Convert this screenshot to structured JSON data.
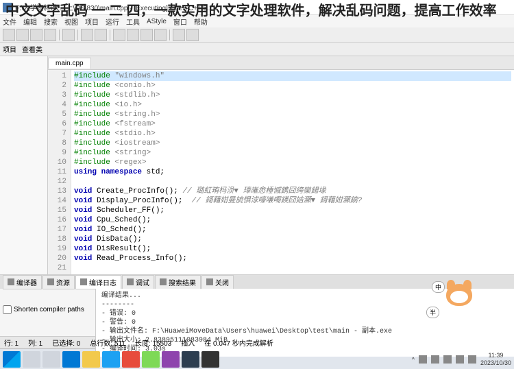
{
  "overlay": "中文文字乱码 一 二 四，一款实用的文字处理软件，解决乱码问题，提高工作效率",
  "titlebar": "F:\\大学资料\\大三上\\OS\\830\\main.cpp - [Executing] - Dev-C++ 5.11",
  "menubar": [
    "文件",
    "编辑",
    "搜索",
    "视图",
    "项目",
    "运行",
    "工具",
    "AStyle",
    "窗口",
    "帮助"
  ],
  "toolbar2": {
    "left": "项目",
    "right": "查看类"
  },
  "tab": "main.cpp",
  "code": [
    {
      "n": 1,
      "t": "#include",
      "a": "\"windows.h\"",
      "hl": true
    },
    {
      "n": 2,
      "t": "#include",
      "a": "<conio.h>"
    },
    {
      "n": 3,
      "t": "#include",
      "a": "<stdlib.h>"
    },
    {
      "n": 4,
      "t": "#include",
      "a": "<io.h>"
    },
    {
      "n": 5,
      "t": "#include",
      "a": "<string.h>"
    },
    {
      "n": 6,
      "t": "#include",
      "a": "<fstream>"
    },
    {
      "n": 7,
      "t": "#include",
      "a": "<stdio.h>"
    },
    {
      "n": 8,
      "t": "#include",
      "a": "<iostream>"
    },
    {
      "n": 9,
      "t": "#include",
      "a": "<string>"
    },
    {
      "n": 10,
      "t": "#include",
      "a": "<regex>"
    },
    {
      "n": 11,
      "kw": "using namespace",
      "id": " std;"
    },
    {
      "n": 12,
      "blank": true
    },
    {
      "n": 13,
      "ty": "void",
      "id": " Create_ProcInfo(); ",
      "cm": "// 璐虹珛杩涢▼ 璋嶉悆棰慽鎸囧绔欒鍚堟"
    },
    {
      "n": 14,
      "ty": "void",
      "id": " Display_ProcInfo();  ",
      "cm": "// 鎶藉姏曼旈惧浗嚎嗛噣鍈囧姞灦▼ 鎶藉姏灦鎬?"
    },
    {
      "n": 15,
      "ty": "void",
      "id": " Scheduler_FF();"
    },
    {
      "n": 16,
      "ty": "void",
      "id": " Cpu_Sched();"
    },
    {
      "n": 17,
      "ty": "void",
      "id": " IO_Sched();"
    },
    {
      "n": 18,
      "ty": "void",
      "id": " DisData();"
    },
    {
      "n": 19,
      "ty": "void",
      "id": " DisResult();"
    },
    {
      "n": 20,
      "ty": "void",
      "id": " Read_Process_Info();"
    },
    {
      "n": 21,
      "blank": true
    }
  ],
  "bottom_tabs": [
    "编译器",
    "资源",
    "编译日志",
    "调试",
    "搜索结果",
    "关闭"
  ],
  "bottom_active": 2,
  "shorten_label": "Shorten compiler paths",
  "compile_output": [
    "编译结果...",
    "--------",
    "- 错误: 0",
    "- 警告: 0",
    "- 输出文件名: F:\\HuaweiMoveData\\Users\\huawei\\Desktop\\test\\main - 副本.exe",
    "- 输出大小: 2.83895111083984 MiB",
    "- 编译时间: 3.03s"
  ],
  "statusbar": {
    "line": "行: 1",
    "col": "列: 1",
    "sel": "已选择: 0",
    "total": "总行数: 511",
    "len": "长度: 15503",
    "ins": "插入",
    "done": "在 0.047 秒内完成解析"
  },
  "clock": {
    "time": "11:39",
    "date": "2023/10/30"
  },
  "mascot": {
    "b1": "中",
    "b2": "半"
  }
}
